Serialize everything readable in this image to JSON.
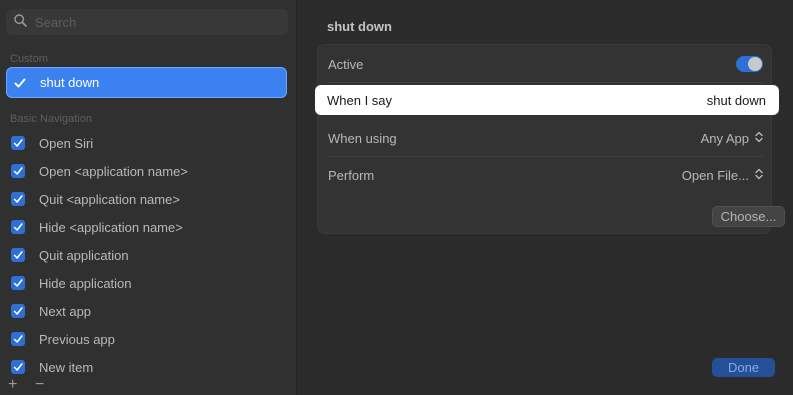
{
  "search": {
    "placeholder": "Search"
  },
  "sidebar": {
    "custom_header": "Custom",
    "selected_item": "shut down",
    "nav_header": "Basic Navigation",
    "commands": [
      "Open Siri",
      "Open <application name>",
      "Quit <application name>",
      "Hide <application name>",
      "Quit application",
      "Hide application",
      "Next app",
      "Previous app",
      "New item"
    ],
    "add_symbol": "+",
    "remove_symbol": "−"
  },
  "detail": {
    "title": "shut down",
    "active_label": "Active",
    "active_on": true,
    "when_i_say_label": "When I say",
    "when_i_say_value": "shut down",
    "when_using_label": "When using",
    "when_using_value": "Any App",
    "perform_label": "Perform",
    "perform_value": "Open File...",
    "choose_label": "Choose...",
    "done_label": "Done"
  },
  "colors": {
    "accent": "#3b82f0",
    "background": "#2b2b2b",
    "sidebar": "#303030"
  },
  "icons": {
    "search": "search-icon",
    "checkmark": "checkmark-icon",
    "stepper": "updown-chevron-icon"
  }
}
